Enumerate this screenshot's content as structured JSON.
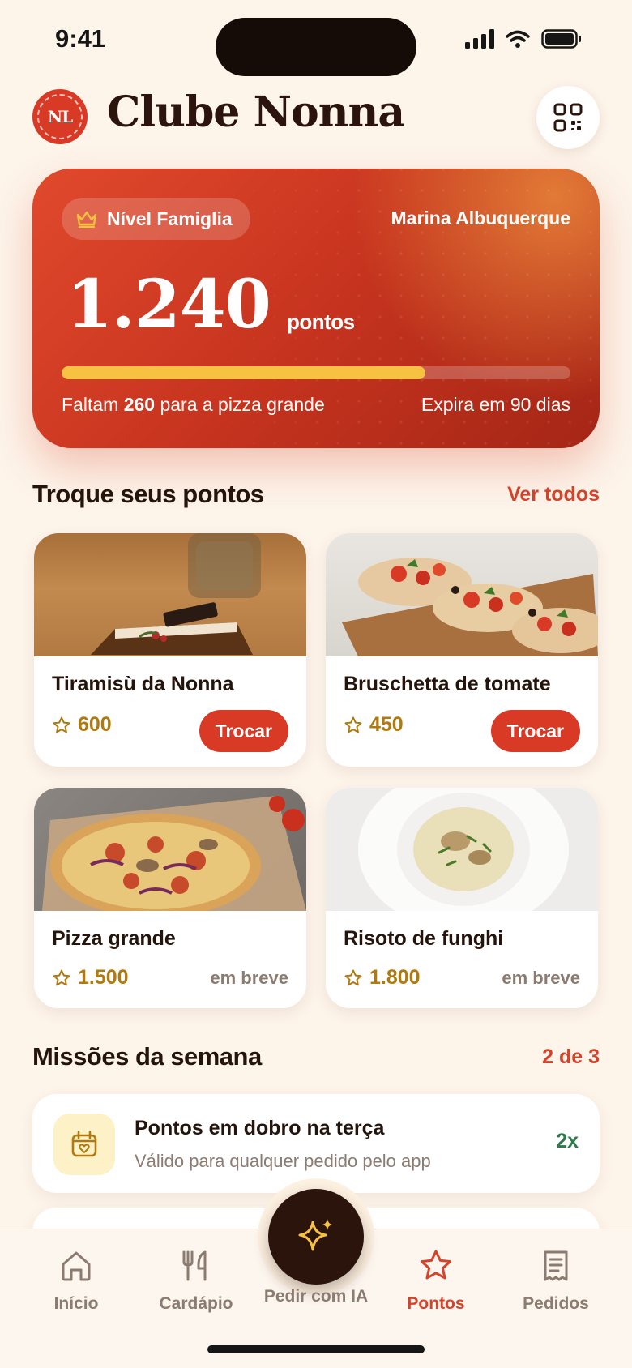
{
  "status_bar": {
    "time": "9:41"
  },
  "header": {
    "logo_text": "NL",
    "title": "Clube Nonna"
  },
  "points_card": {
    "level": "Nível Famiglia",
    "member_name": "Marina Albuquerque",
    "points": "1.240",
    "points_unit": "pontos",
    "progress_fraction": 0.715,
    "remaining_prefix": "Faltam",
    "remaining_value": "260",
    "remaining_suffix": "para a pizza grande",
    "expiry": "Expira em 90 dias"
  },
  "rewards_section": {
    "title": "Troque seus pontos",
    "link": "Ver todos",
    "items": [
      {
        "name": "Tiramisù da Nonna",
        "cost": "600",
        "action": "Trocar"
      },
      {
        "name": "Bruschetta de tomate",
        "cost": "450",
        "action": "Trocar"
      },
      {
        "name": "Pizza grande",
        "cost": "1.500",
        "status": "em breve"
      },
      {
        "name": "Risoto de funghi",
        "cost": "1.800",
        "status": "em breve"
      }
    ]
  },
  "missions_section": {
    "title": "Missões da semana",
    "progress": "2 de 3",
    "items": [
      {
        "title": "Pontos em dobro na terça",
        "subtitle": "Válido para qualquer pedido pelo app",
        "multiplier": "2x"
      }
    ]
  },
  "bottom_nav": {
    "items": [
      {
        "label": "Início",
        "icon": "home-icon"
      },
      {
        "label": "Cardápio",
        "icon": "cutlery-icon"
      },
      {
        "label": "Pedir com IA",
        "icon": "sparkle-icon"
      },
      {
        "label": "Pontos",
        "icon": "star-icon",
        "active": true
      },
      {
        "label": "Pedidos",
        "icon": "receipt-icon"
      }
    ]
  },
  "colors": {
    "accent": "#d83a25",
    "background": "#fdf4ea",
    "gold": "#f7c142",
    "dark": "#2a140c",
    "success": "#2f7a4a"
  }
}
